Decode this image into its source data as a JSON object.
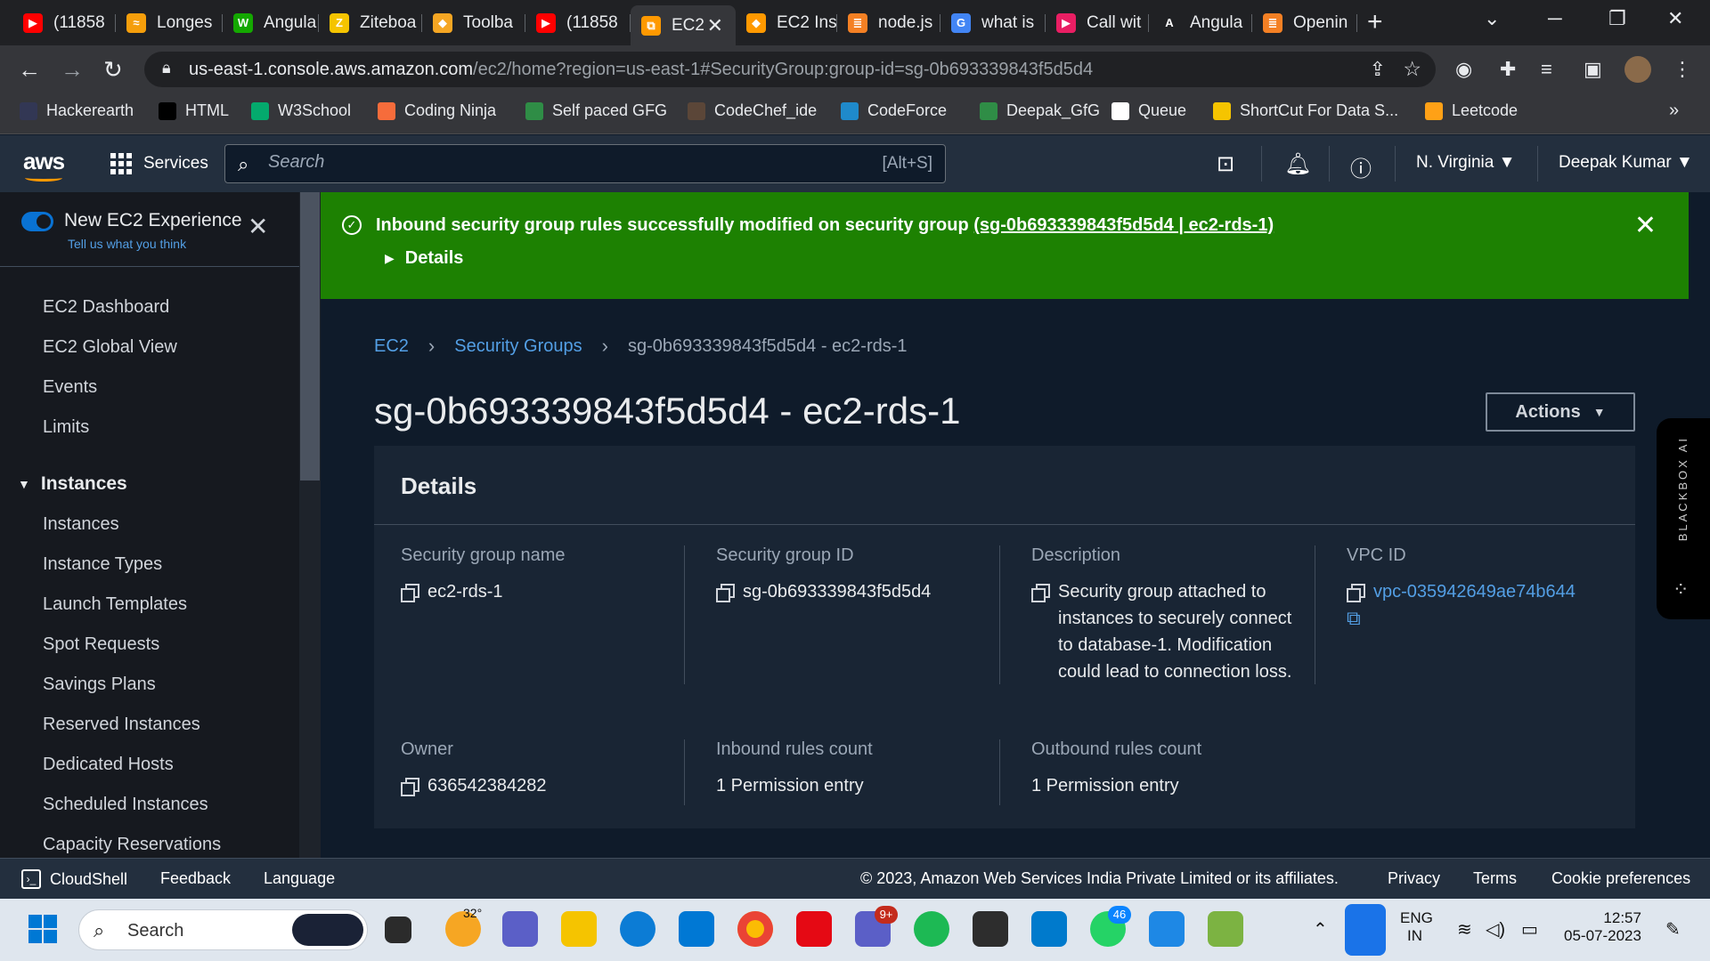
{
  "browser": {
    "tabs": [
      {
        "label": "(11858",
        "color": "#ff0000",
        "glyph": "▶"
      },
      {
        "label": "Longes",
        "color": "#f59e0b",
        "glyph": "≈"
      },
      {
        "label": "Angula",
        "color": "#14a800",
        "glyph": "W"
      },
      {
        "label": "Ziteboa",
        "color": "#f5c400",
        "glyph": "Z"
      },
      {
        "label": "Toolba",
        "color": "#f5a623",
        "glyph": "◆"
      },
      {
        "label": "(11858",
        "color": "#ff0000",
        "glyph": "▶"
      },
      {
        "label": "EC2",
        "color": "#ff9900",
        "glyph": "⧉",
        "active": true
      },
      {
        "label": "EC2 Ins",
        "color": "#ff9900",
        "glyph": "◆"
      },
      {
        "label": "node.js",
        "color": "#f48024",
        "glyph": "≣"
      },
      {
        "label": "what is",
        "color": "#4285f4",
        "glyph": "G"
      },
      {
        "label": "Call wit",
        "color": "#e91e63",
        "glyph": "▶"
      },
      {
        "label": "Angula",
        "color": "#202124",
        "glyph": "A"
      },
      {
        "label": "Openin",
        "color": "#f48024",
        "glyph": "≣"
      }
    ],
    "new_tab": "+",
    "url_host": "us-east-1.console.aws.amazon.com",
    "url_path": "/ec2/home?region=us-east-1#SecurityGroup:group-id=sg-0b693339843f5d5d4",
    "bookmarks": [
      {
        "label": "Hackerearth",
        "color": "#323754"
      },
      {
        "label": "HTML",
        "color": "#000000"
      },
      {
        "label": "W3School",
        "color": "#04aa6d"
      },
      {
        "label": "Coding Ninja",
        "color": "#f66c3b"
      },
      {
        "label": "Self paced GFG",
        "color": "#2f8d46"
      },
      {
        "label": "CodeChef_ide",
        "color": "#5b4638"
      },
      {
        "label": "CodeForce",
        "color": "#1f8acb"
      },
      {
        "label": "Deepak_GfG",
        "color": "#2f8d46"
      },
      {
        "label": "Queue",
        "color": "#ffffff"
      },
      {
        "label": "ShortCut For Data S...",
        "color": "#f5c400"
      },
      {
        "label": "Leetcode",
        "color": "#ffa116"
      }
    ],
    "more_bookmarks": "»"
  },
  "aws": {
    "logo": "aws",
    "services": "Services",
    "search_placeholder": "Search",
    "search_shortcut": "[Alt+S]",
    "region": "N. Virginia",
    "user": "Deepak Kumar"
  },
  "sidebar": {
    "new_experience_title": "New EC2 Experience",
    "new_experience_sub": "Tell us what you think",
    "top_items": [
      "EC2 Dashboard",
      "EC2 Global View",
      "Events",
      "Limits"
    ],
    "section": "Instances",
    "section_items": [
      "Instances",
      "Instance Types",
      "Launch Templates",
      "Spot Requests",
      "Savings Plans",
      "Reserved Instances",
      "Dedicated Hosts",
      "Scheduled Instances",
      "Capacity Reservations"
    ]
  },
  "flash": {
    "message": "Inbound security group rules successfully modified on security group ",
    "link": "(sg-0b693339843f5d5d4 | ec2-rds-1)",
    "details": "Details"
  },
  "breadcrumb": {
    "root": "EC2",
    "parent": "Security Groups",
    "current": "sg-0b693339843f5d5d4 - ec2-rds-1"
  },
  "page": {
    "title": "sg-0b693339843f5d5d4 - ec2-rds-1",
    "actions": "Actions"
  },
  "details": {
    "header": "Details",
    "sg_name_label": "Security group name",
    "sg_name": "ec2-rds-1",
    "sg_id_label": "Security group ID",
    "sg_id": "sg-0b693339843f5d5d4",
    "description_label": "Description",
    "description": "Security group attached to instances to securely connect to database-1. Modification could lead to connection loss.",
    "vpc_label": "VPC ID",
    "vpc": "vpc-035942649ae74b644",
    "owner_label": "Owner",
    "owner": "636542384282",
    "inbound_label": "Inbound rules count",
    "inbound": "1 Permission entry",
    "outbound_label": "Outbound rules count",
    "outbound": "1 Permission entry"
  },
  "blackbox": "BLACKBOX AI",
  "footer": {
    "cloudshell": "CloudShell",
    "feedback": "Feedback",
    "language": "Language",
    "copyright": "© 2023, Amazon Web Services India Private Limited or its affiliates.",
    "privacy": "Privacy",
    "terms": "Terms",
    "cookie": "Cookie preferences"
  },
  "taskbar": {
    "search": "Search",
    "weather": "32°",
    "teams_badge": "9+",
    "whatsapp_badge": "46",
    "lang1": "ENG",
    "lang2": "IN",
    "time": "12:57",
    "date": "05-07-2023"
  }
}
